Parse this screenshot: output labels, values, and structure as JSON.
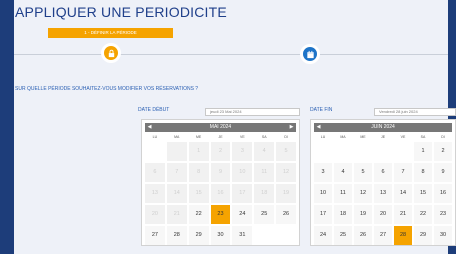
{
  "title": "APPLIQUER UNE PERIODICITE",
  "steps": {
    "step1_label": "1 - DÉFINIR LA PÉRIODE"
  },
  "question": "SUR QUELLE PÉRIODE SOUHAITEZ-VOUS MODIFIER VOS RÉSERVATIONS ?",
  "start": {
    "label": "DATE DÉBUT",
    "value": "jeudi 23 Mai 2024"
  },
  "end": {
    "label": "DATE FIN",
    "value": "Vendredi 28 juin 2024"
  },
  "dow": [
    "LU",
    "MA",
    "ME",
    "JE",
    "VE",
    "SA",
    "DI"
  ],
  "nav": {
    "prev": "◀",
    "next": "▶"
  },
  "cal_left": {
    "month": "MAI 2024",
    "cells": [
      {
        "d": "",
        "s": "empty"
      },
      {
        "d": "",
        "s": "dis"
      },
      {
        "d": "1",
        "s": "dis"
      },
      {
        "d": "2",
        "s": "dis"
      },
      {
        "d": "3",
        "s": "dis"
      },
      {
        "d": "4",
        "s": "dis"
      },
      {
        "d": "5",
        "s": "dis"
      },
      {
        "d": "6",
        "s": "dis"
      },
      {
        "d": "7",
        "s": "dis"
      },
      {
        "d": "8",
        "s": "dis"
      },
      {
        "d": "9",
        "s": "dis"
      },
      {
        "d": "10",
        "s": "dis"
      },
      {
        "d": "11",
        "s": "dis"
      },
      {
        "d": "12",
        "s": "dis"
      },
      {
        "d": "13",
        "s": "dis"
      },
      {
        "d": "14",
        "s": "dis"
      },
      {
        "d": "15",
        "s": "dis"
      },
      {
        "d": "16",
        "s": "dis"
      },
      {
        "d": "17",
        "s": "dis"
      },
      {
        "d": "18",
        "s": "dis"
      },
      {
        "d": "19",
        "s": "dis"
      },
      {
        "d": "20",
        "s": "dis"
      },
      {
        "d": "21",
        "s": "dis"
      },
      {
        "d": "22",
        "s": ""
      },
      {
        "d": "23",
        "s": "sel"
      },
      {
        "d": "24",
        "s": ""
      },
      {
        "d": "25",
        "s": ""
      },
      {
        "d": "26",
        "s": ""
      },
      {
        "d": "27",
        "s": ""
      },
      {
        "d": "28",
        "s": ""
      },
      {
        "d": "29",
        "s": ""
      },
      {
        "d": "30",
        "s": ""
      },
      {
        "d": "31",
        "s": ""
      },
      {
        "d": "",
        "s": "empty"
      },
      {
        "d": "",
        "s": "empty"
      }
    ]
  },
  "cal_right": {
    "month": "JUIN 2024",
    "cells": [
      {
        "d": "",
        "s": "empty"
      },
      {
        "d": "",
        "s": "empty"
      },
      {
        "d": "",
        "s": "empty"
      },
      {
        "d": "",
        "s": "empty"
      },
      {
        "d": "",
        "s": "empty"
      },
      {
        "d": "1",
        "s": ""
      },
      {
        "d": "2",
        "s": ""
      },
      {
        "d": "3",
        "s": ""
      },
      {
        "d": "4",
        "s": ""
      },
      {
        "d": "5",
        "s": ""
      },
      {
        "d": "6",
        "s": ""
      },
      {
        "d": "7",
        "s": ""
      },
      {
        "d": "8",
        "s": ""
      },
      {
        "d": "9",
        "s": ""
      },
      {
        "d": "10",
        "s": ""
      },
      {
        "d": "11",
        "s": ""
      },
      {
        "d": "12",
        "s": ""
      },
      {
        "d": "13",
        "s": ""
      },
      {
        "d": "14",
        "s": ""
      },
      {
        "d": "15",
        "s": ""
      },
      {
        "d": "16",
        "s": ""
      },
      {
        "d": "17",
        "s": ""
      },
      {
        "d": "18",
        "s": ""
      },
      {
        "d": "19",
        "s": ""
      },
      {
        "d": "20",
        "s": ""
      },
      {
        "d": "21",
        "s": ""
      },
      {
        "d": "22",
        "s": ""
      },
      {
        "d": "23",
        "s": ""
      },
      {
        "d": "24",
        "s": ""
      },
      {
        "d": "25",
        "s": ""
      },
      {
        "d": "26",
        "s": ""
      },
      {
        "d": "27",
        "s": ""
      },
      {
        "d": "28",
        "s": "sel"
      },
      {
        "d": "29",
        "s": ""
      },
      {
        "d": "30",
        "s": ""
      }
    ]
  },
  "colors": {
    "accent": "#f5a300",
    "brand": "#1d3d7a",
    "step_active": "#1e74c8"
  },
  "icons": {
    "step1": "lock-icon",
    "step2": "calendar-icon"
  }
}
